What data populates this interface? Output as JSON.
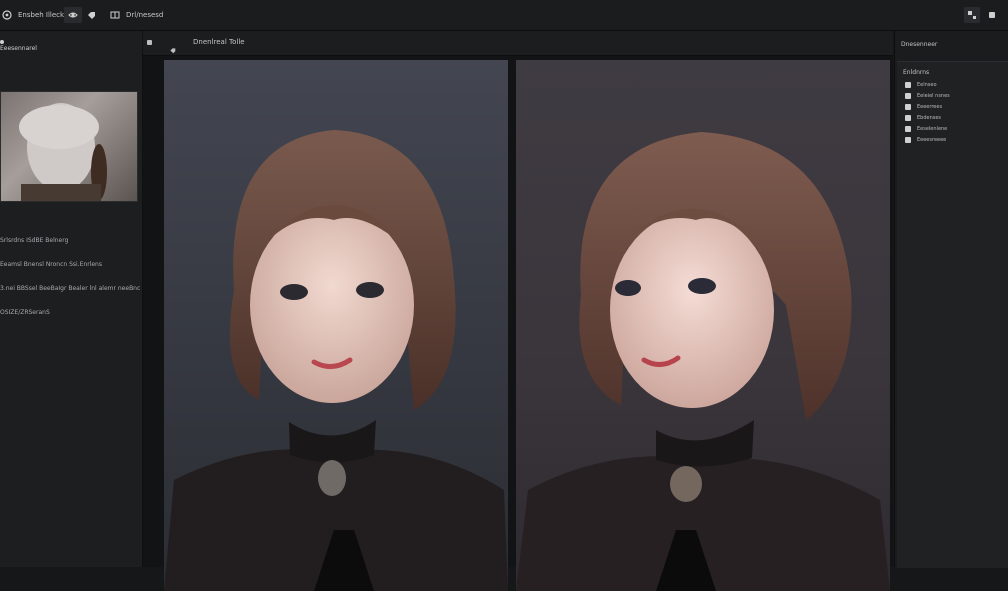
{
  "topbar": {
    "app_label": "Ensbeh Illeckd",
    "view_label": "Drl/nesesd"
  },
  "left_panel": {
    "header": "Eeesennarel",
    "meta_lines": [
      "Srlsrdns ISdBE Belnerg",
      "Eeamsl Bnensl Nroncn Ssi.Enrlens",
      "3.nei BBSsel BeeBaIgr Bealer lnl alemr neeBnc",
      "OSIZE/ZRSeranS"
    ]
  },
  "center": {
    "title": "Dnenlreal Tolle"
  },
  "right_panel": {
    "header": "Dnesenneer",
    "subheader": "Enldnrns",
    "items": [
      "Eelnseo",
      "Eeieiel nsnes",
      "Eeeerrees",
      "Ebdenses",
      "Eeselenlene",
      "Eeeesreeee"
    ]
  },
  "icons": {
    "app": "app-icon",
    "view": "eye-icon",
    "tag": "tag-icon",
    "window": "window-icon"
  }
}
